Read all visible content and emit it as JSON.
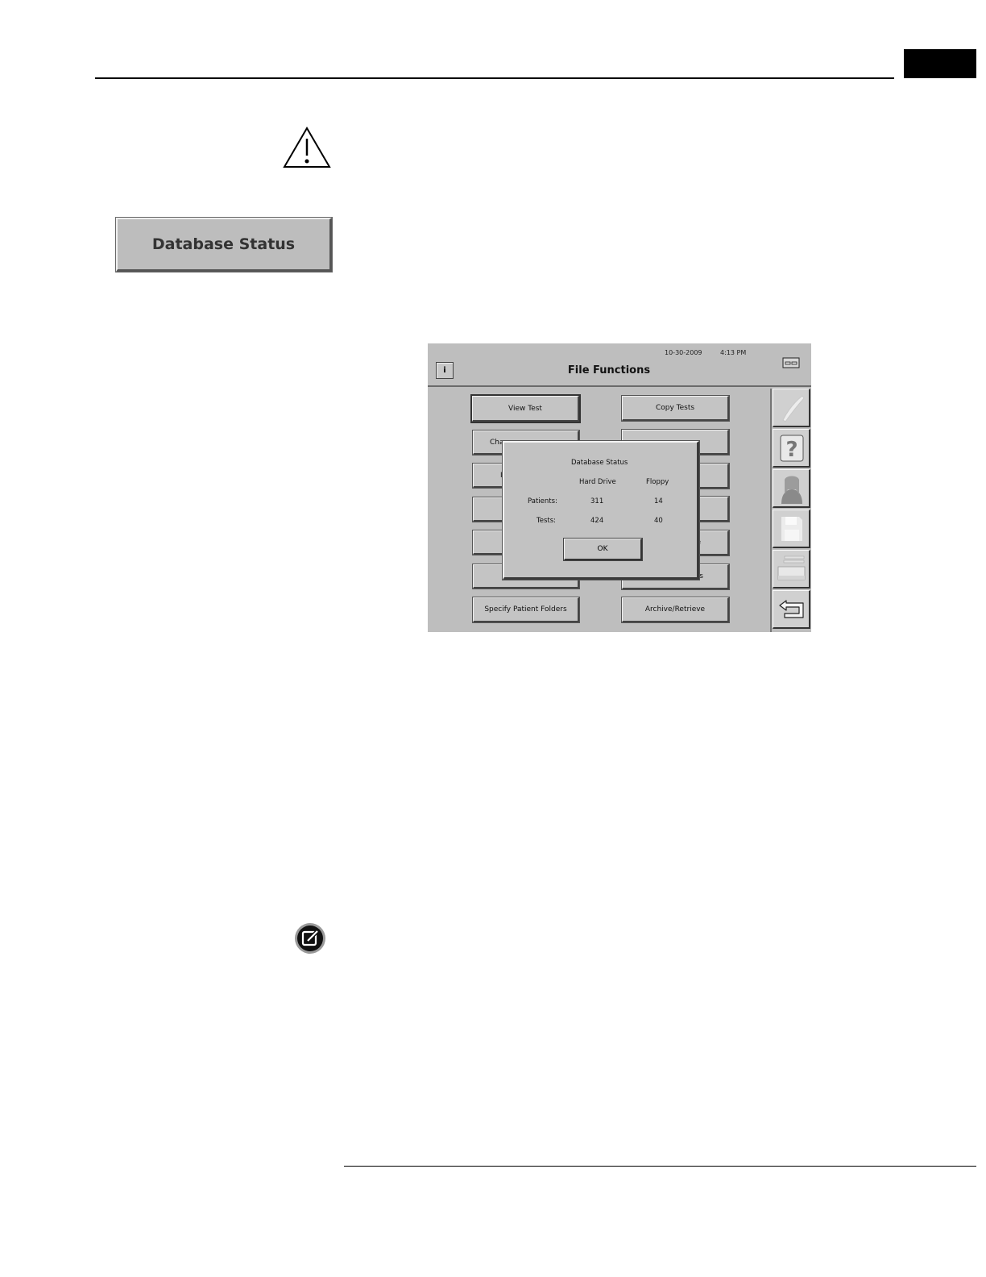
{
  "left_column": {
    "database_status_button": "Database Status"
  },
  "screen": {
    "date": "10-30-2009",
    "time": "4:13 PM",
    "title": "File Functions",
    "info_button": "i",
    "left_buttons": [
      "View Test",
      "Cha",
      "I",
      "",
      "",
      "",
      "Specify Patient Folders"
    ],
    "right_buttons": [
      "Copy Tests",
      "",
      "",
      "s",
      "e",
      "s",
      "Archive/Retrieve"
    ],
    "side_icons": [
      "pen-icon",
      "help-icon",
      "patient-icon",
      "floppy-disk-icon",
      "printer-icon",
      "return-arrow-icon"
    ],
    "dialog": {
      "title": "Database Status",
      "col_hard_drive": "Hard Drive",
      "col_floppy": "Floppy",
      "row_patients_label": "Patients:",
      "patients_hard_drive": "311",
      "patients_floppy": "14",
      "row_tests_label": "Tests:",
      "tests_hard_drive": "424",
      "tests_floppy": "40",
      "ok": "OK"
    }
  }
}
